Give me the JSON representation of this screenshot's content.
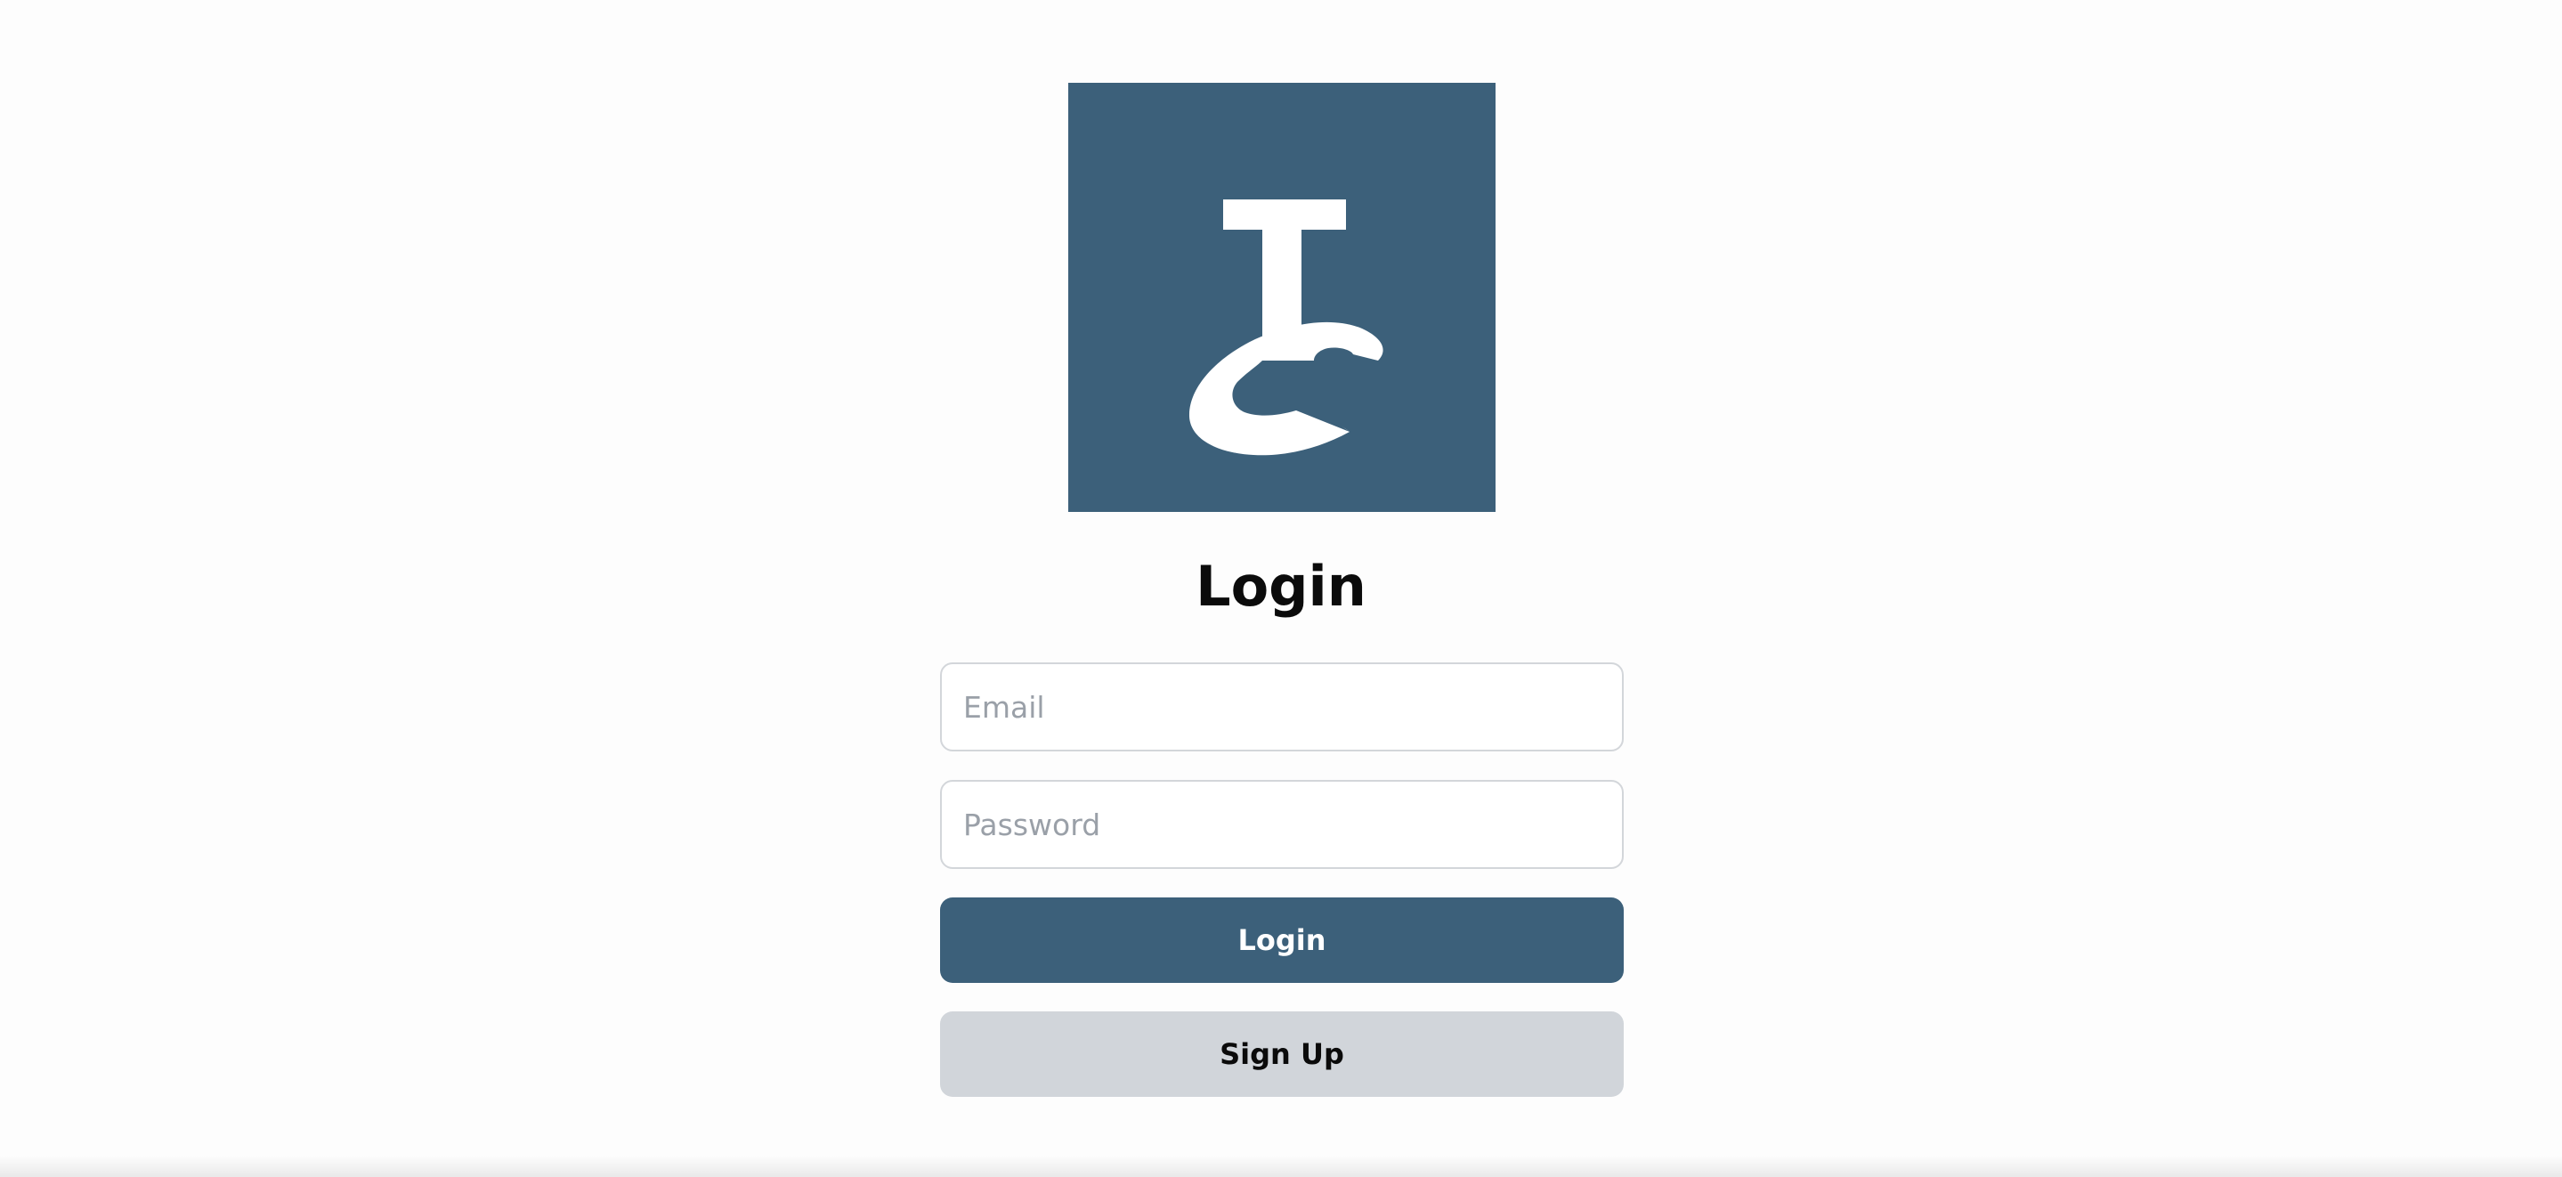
{
  "colors": {
    "brand": "#3c607a",
    "background": "#fdfdfd",
    "secondary_button": "#d1d5da"
  },
  "logo": {
    "icon": "tc-monogram-logo",
    "letters": "TC"
  },
  "form": {
    "title": "Login",
    "email_placeholder": "Email",
    "email_value": "",
    "password_placeholder": "Password",
    "password_value": "",
    "login_label": "Login",
    "signup_label": "Sign Up"
  }
}
